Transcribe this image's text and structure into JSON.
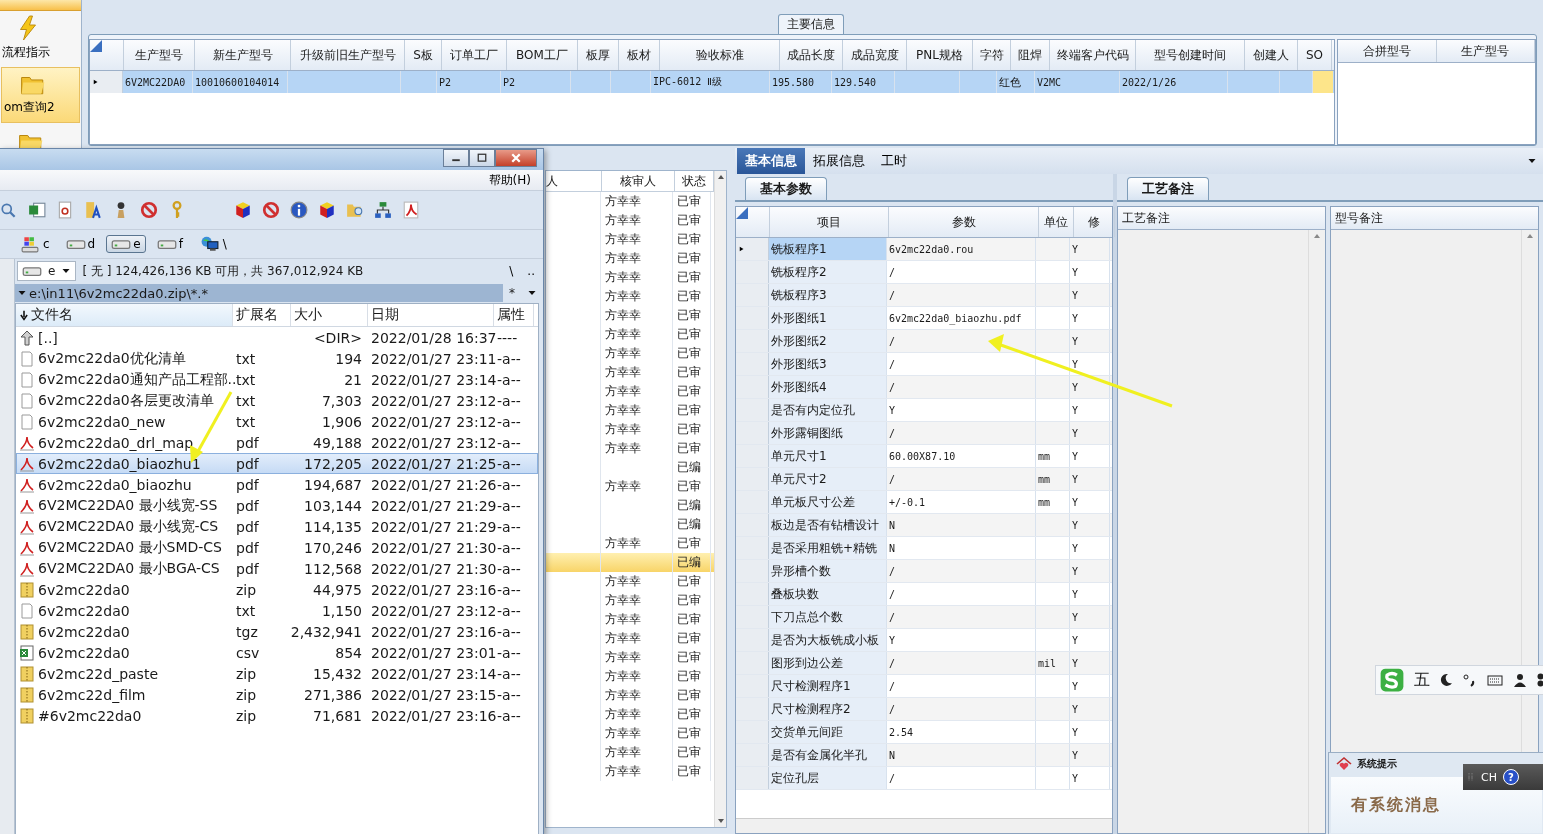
{
  "sidebar": {
    "items": [
      {
        "label": "流程指示",
        "selected": false
      },
      {
        "label": "om查询2",
        "selected": true
      }
    ]
  },
  "main_info": {
    "title": "主要信息",
    "columns": [
      "生产型号",
      "新生产型号",
      "升级前旧生产型号",
      "S板",
      "订单工厂",
      "BOM工厂",
      "板厚",
      "板材",
      "验收标准",
      "成品长度",
      "成品宽度",
      "PNL规格",
      "字符",
      "阻焊",
      "终端客户代码",
      "型号创建时间",
      "创建人",
      "SO"
    ],
    "rows": [
      {
        "selected": true,
        "cells": [
          "6V2MC22DA0",
          "10010600104014",
          null,
          null,
          "P2",
          "P2",
          null,
          null,
          "IPC-6012 Ⅱ级",
          "195.580",
          "129.540",
          null,
          null,
          "红色",
          "V2MC",
          "2022/1/26",
          null,
          null
        ]
      }
    ]
  },
  "merge_grid": {
    "columns": [
      "合拼型号",
      "生产型号"
    ]
  },
  "review_list": {
    "columns": [
      "人",
      "核审人",
      "状态"
    ],
    "rows": [
      {
        "reviewer": "方幸幸",
        "status": "已审",
        "selected": false
      },
      {
        "reviewer": "方幸幸",
        "status": "已审",
        "selected": false
      },
      {
        "reviewer": "方幸幸",
        "status": "已审",
        "selected": false
      },
      {
        "reviewer": "方幸幸",
        "status": "已审",
        "selected": false
      },
      {
        "reviewer": "方幸幸",
        "status": "已审",
        "selected": false
      },
      {
        "reviewer": "方幸幸",
        "status": "已审",
        "selected": false
      },
      {
        "reviewer": "方幸幸",
        "status": "已审",
        "selected": false
      },
      {
        "reviewer": "方幸幸",
        "status": "已审",
        "selected": false
      },
      {
        "reviewer": "方幸幸",
        "status": "已审",
        "selected": false
      },
      {
        "reviewer": "方幸幸",
        "status": "已审",
        "selected": false
      },
      {
        "reviewer": "方幸幸",
        "status": "已审",
        "selected": false
      },
      {
        "reviewer": "方幸幸",
        "status": "已审",
        "selected": false
      },
      {
        "reviewer": "方幸幸",
        "status": "已审",
        "selected": false
      },
      {
        "reviewer": "方幸幸",
        "status": "已审",
        "selected": false
      },
      {
        "reviewer": null,
        "status": "已编",
        "selected": false
      },
      {
        "reviewer": "方幸幸",
        "status": "已审",
        "selected": false
      },
      {
        "reviewer": null,
        "status": "已编",
        "selected": false
      },
      {
        "reviewer": null,
        "status": "已编",
        "selected": false
      },
      {
        "reviewer": "方幸幸",
        "status": "已审",
        "selected": false
      },
      {
        "reviewer": null,
        "status": "已编",
        "selected": true
      },
      {
        "reviewer": "方幸幸",
        "status": "已审",
        "selected": false
      },
      {
        "reviewer": "方幸幸",
        "status": "已审",
        "selected": false
      },
      {
        "reviewer": "方幸幸",
        "status": "已审",
        "selected": false
      },
      {
        "reviewer": "方幸幸",
        "status": "已审",
        "selected": false
      },
      {
        "reviewer": "方幸幸",
        "status": "已审",
        "selected": false
      },
      {
        "reviewer": "方幸幸",
        "status": "已审",
        "selected": false
      },
      {
        "reviewer": "方幸幸",
        "status": "已审",
        "selected": false
      },
      {
        "reviewer": "方幸幸",
        "status": "已审",
        "selected": false
      },
      {
        "reviewer": "方幸幸",
        "status": "已审",
        "selected": false
      },
      {
        "reviewer": "方幸幸",
        "status": "已审",
        "selected": false
      },
      {
        "reviewer": "方幸幸",
        "status": "已审",
        "selected": false
      }
    ]
  },
  "tabs": [
    {
      "label": "基本信息",
      "selected": true
    },
    {
      "label": "拓展信息",
      "selected": false
    },
    {
      "label": "工时",
      "selected": false
    }
  ],
  "params": {
    "subtab": "基本参数",
    "columns": [
      "项目",
      "参数",
      "单位",
      "修"
    ],
    "rows": [
      {
        "item": "铣板程序1",
        "value": "6v2mc22da0.rou",
        "unit": null,
        "modified": "Y",
        "selected": true
      },
      {
        "item": "铣板程序2",
        "value": "/",
        "unit": null,
        "modified": "Y",
        "selected": false
      },
      {
        "item": "铣板程序3",
        "value": "/",
        "unit": null,
        "modified": "Y",
        "selected": false
      },
      {
        "item": "外形图纸1",
        "value": "6v2mc22da0_biaozhu.pdf",
        "unit": null,
        "modified": "Y",
        "selected": false
      },
      {
        "item": "外形图纸2",
        "value": "/",
        "unit": null,
        "modified": "Y",
        "selected": false
      },
      {
        "item": "外形图纸3",
        "value": "/",
        "unit": null,
        "modified": "Y",
        "selected": false
      },
      {
        "item": "外形图纸4",
        "value": "/",
        "unit": null,
        "modified": "Y",
        "selected": false
      },
      {
        "item": "是否有内定位孔",
        "value": "Y",
        "unit": null,
        "modified": "Y",
        "selected": false
      },
      {
        "item": "外形露铜图纸",
        "value": "/",
        "unit": null,
        "modified": "Y",
        "selected": false
      },
      {
        "item": "单元尺寸1",
        "value": "60.00X87.10",
        "unit": "mm",
        "modified": "Y",
        "selected": false
      },
      {
        "item": "单元尺寸2",
        "value": "/",
        "unit": "mm",
        "modified": "Y",
        "selected": false
      },
      {
        "item": "单元板尺寸公差",
        "value": "+/-0.1",
        "unit": "mm",
        "modified": "Y",
        "selected": false
      },
      {
        "item": "板边是否有钻槽设计",
        "value": "N",
        "unit": null,
        "modified": "Y",
        "selected": false
      },
      {
        "item": "是否采用粗铣+精铣",
        "value": "N",
        "unit": null,
        "modified": "Y",
        "selected": false
      },
      {
        "item": "异形槽个数",
        "value": "/",
        "unit": null,
        "modified": "Y",
        "selected": false
      },
      {
        "item": "叠板块数",
        "value": "/",
        "unit": null,
        "modified": "Y",
        "selected": false
      },
      {
        "item": "下刀点总个数",
        "value": "/",
        "unit": null,
        "modified": "Y",
        "selected": false
      },
      {
        "item": "是否为大板铣成小板",
        "value": "Y",
        "unit": null,
        "modified": "Y",
        "selected": false
      },
      {
        "item": "图形到边公差",
        "value": "/",
        "unit": "mil",
        "modified": "Y",
        "selected": false
      },
      {
        "item": "尺寸检测程序1",
        "value": "/",
        "unit": null,
        "modified": "Y",
        "selected": false
      },
      {
        "item": "尺寸检测程序2",
        "value": "/",
        "unit": null,
        "modified": "Y",
        "selected": false
      },
      {
        "item": "交货单元间距",
        "value": "2.54",
        "unit": null,
        "modified": "Y",
        "selected": false
      },
      {
        "item": "是否有金属化半孔",
        "value": "N",
        "unit": null,
        "modified": "Y",
        "selected": false
      },
      {
        "item": "定位孔层",
        "value": "/",
        "unit": null,
        "modified": "Y",
        "selected": false
      }
    ]
  },
  "notes": {
    "tab": "工艺备注",
    "columns": [
      "工艺备注",
      "型号备注"
    ]
  },
  "ime_bar": {
    "mode": "五"
  },
  "system_popup": {
    "title": "系统提示",
    "message": "有系统消息"
  },
  "language_bar": {
    "code": "CH",
    "help": "?"
  },
  "file_manager": {
    "menu": [
      "帮助(H)"
    ],
    "drives": [
      {
        "label": "c",
        "kind": "system",
        "selected": false
      },
      {
        "label": "d",
        "kind": "disk",
        "selected": false
      },
      {
        "label": "e",
        "kind": "disk",
        "selected": true
      },
      {
        "label": "f",
        "kind": "disk",
        "selected": false
      },
      {
        "label": "\\",
        "kind": "network",
        "selected": false
      }
    ],
    "drive_combo": "e",
    "free_space": "[ 无 ] 124,426,136 KB 可用，共 367,012,924 KB",
    "nav": [
      "\\",
      ".."
    ],
    "path": "e:\\in11\\6v2mc22da0.zip\\*.*",
    "filter": "*",
    "columns": [
      "文件名",
      "扩展名",
      "大小",
      "日期",
      "属性"
    ],
    "files": [
      {
        "kind": "up",
        "name": "[..]",
        "size": "<DIR>",
        "date": "2022/01/28 16:37",
        "attr": "----",
        "selected": false
      },
      {
        "kind": "text",
        "name": "6v2mc22da0优化清单",
        "ext": "txt",
        "size": "194",
        "date": "2022/01/27 23:11",
        "attr": "-a--",
        "selected": false
      },
      {
        "kind": "text",
        "name": "6v2mc22da0通知产品工程部..",
        "ext": "txt",
        "size": "21",
        "date": "2022/01/27 23:14",
        "attr": "-a--",
        "selected": false
      },
      {
        "kind": "text",
        "name": "6v2mc22da0各层更改清单",
        "ext": "txt",
        "size": "7,303",
        "date": "2022/01/27 23:12",
        "attr": "-a--",
        "selected": false
      },
      {
        "kind": "text",
        "name": "6v2mc22da0_new",
        "ext": "txt",
        "size": "1,906",
        "date": "2022/01/27 23:12",
        "attr": "-a--",
        "selected": false
      },
      {
        "kind": "pdf",
        "name": "6v2mc22da0_drl_map",
        "ext": "pdf",
        "size": "49,188",
        "date": "2022/01/27 23:12",
        "attr": "-a--",
        "selected": false
      },
      {
        "kind": "pdf",
        "name": "6v2mc22da0_biaozhu1",
        "ext": "pdf",
        "size": "172,205",
        "date": "2022/01/27 21:25",
        "attr": "-a--",
        "selected": true
      },
      {
        "kind": "pdf",
        "name": "6v2mc22da0_biaozhu",
        "ext": "pdf",
        "size": "194,687",
        "date": "2022/01/27 21:26",
        "attr": "-a--",
        "selected": false
      },
      {
        "kind": "pdf",
        "name": "6V2MC22DA0 最小线宽-SS",
        "ext": "pdf",
        "size": "103,144",
        "date": "2022/01/27 21:29",
        "attr": "-a--",
        "selected": false
      },
      {
        "kind": "pdf",
        "name": "6V2MC22DA0 最小线宽-CS",
        "ext": "pdf",
        "size": "114,135",
        "date": "2022/01/27 21:29",
        "attr": "-a--",
        "selected": false
      },
      {
        "kind": "pdf",
        "name": "6V2MC22DA0 最小SMD-CS",
        "ext": "pdf",
        "size": "170,246",
        "date": "2022/01/27 21:30",
        "attr": "-a--",
        "selected": false
      },
      {
        "kind": "pdf",
        "name": "6V2MC22DA0 最小BGA-CS",
        "ext": "pdf",
        "size": "112,568",
        "date": "2022/01/27 21:30",
        "attr": "-a--",
        "selected": false
      },
      {
        "kind": "archive",
        "name": "6v2mc22da0",
        "ext": "zip",
        "size": "44,975",
        "date": "2022/01/27 23:16",
        "attr": "-a--",
        "selected": false
      },
      {
        "kind": "text",
        "name": "6v2mc22da0",
        "ext": "txt",
        "size": "1,150",
        "date": "2022/01/27 23:12",
        "attr": "-a--",
        "selected": false
      },
      {
        "kind": "archive",
        "name": "6v2mc22da0",
        "ext": "tgz",
        "size": "2,432,941",
        "date": "2022/01/27 23:16",
        "attr": "-a--",
        "selected": false
      },
      {
        "kind": "sheet",
        "name": "6v2mc22da0",
        "ext": "csv",
        "size": "854",
        "date": "2022/01/27 23:01",
        "attr": "-a--",
        "selected": false
      },
      {
        "kind": "archive",
        "name": "6v2mc22d_paste",
        "ext": "zip",
        "size": "15,432",
        "date": "2022/01/27 23:14",
        "attr": "-a--",
        "selected": false
      },
      {
        "kind": "archive",
        "name": "6v2mc22d_film",
        "ext": "zip",
        "size": "271,386",
        "date": "2022/01/27 23:15",
        "attr": "-a--",
        "selected": false
      },
      {
        "kind": "archive",
        "name": "#6v2mc22da0",
        "ext": "zip",
        "size": "71,681",
        "date": "2022/01/27 23:16",
        "attr": "-a--",
        "selected": false
      }
    ]
  }
}
